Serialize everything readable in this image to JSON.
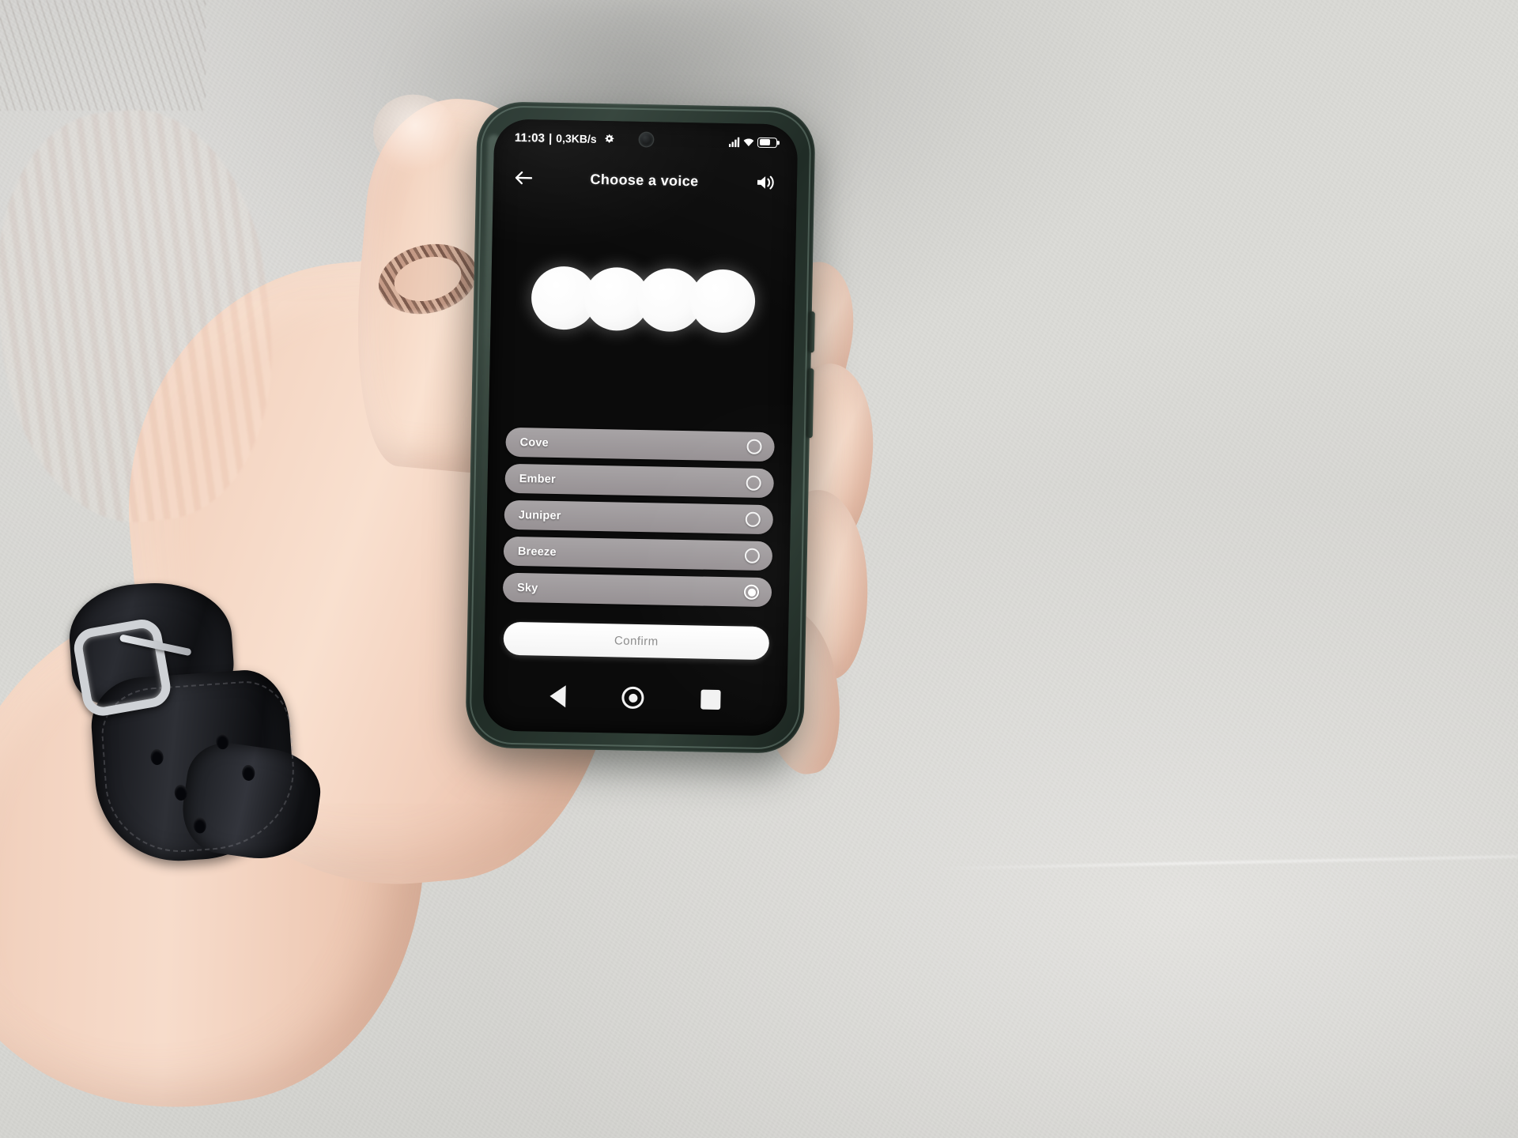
{
  "status_bar": {
    "time": "11:03",
    "separator": "|",
    "data_rate": "0,3KB/s",
    "vpn_icon": "vpn-key-icon",
    "signal_icon": "signal-bars-icon",
    "wifi_icon": "wifi-icon",
    "battery_icon": "battery-icon",
    "battery_level_percent": 58
  },
  "app_bar": {
    "back_icon": "back-arrow-icon",
    "title": "Choose a voice",
    "speaker_icon": "speaker-volume-icon"
  },
  "voice_preview": {
    "orb_count": 4,
    "orb_color": "#ffffff",
    "orb_label": "voice-orb"
  },
  "voice_list": {
    "items": [
      {
        "label": "Cove",
        "selected": false
      },
      {
        "label": "Ember",
        "selected": false
      },
      {
        "label": "Juniper",
        "selected": false
      },
      {
        "label": "Breeze",
        "selected": false
      },
      {
        "label": "Sky",
        "selected": true
      }
    ],
    "row_color": "#aeaaac",
    "label_color": "#ffffff"
  },
  "confirm": {
    "label": "Confirm",
    "background": "#ffffff",
    "text_color": "#8d8d8d"
  },
  "nav_bar": {
    "back_icon": "nav-back-triangle-icon",
    "home_icon": "nav-home-circle-icon",
    "recents_icon": "nav-recents-square-icon"
  },
  "device": {
    "case_color": "#2c3a34",
    "screen_background": "#0b0b0b"
  },
  "scene": {
    "wall_color": "#d8d8d4",
    "skin_tone": "#f3d4c1",
    "watch_strap_color": "#16181c",
    "watch_buckle_color": "#cfd2d6",
    "ring_metal_color": "#c49a86"
  }
}
